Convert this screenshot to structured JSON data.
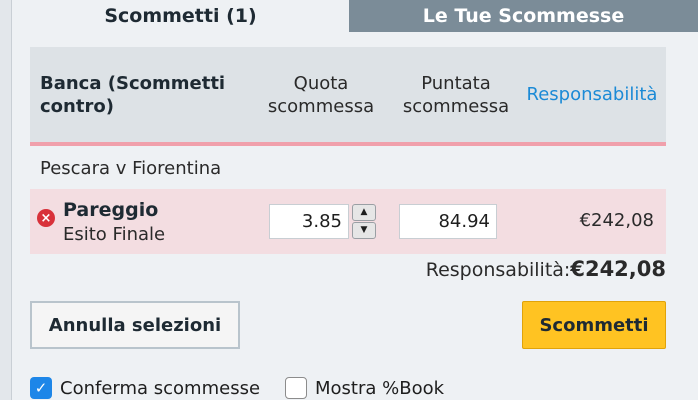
{
  "tabs": {
    "active_label": "Scommetti (1)",
    "inactive_label": "Le Tue Scommesse"
  },
  "table_header": {
    "banca": "Banca (Scommetti contro)",
    "quota": "Quota scommessa",
    "puntata": "Puntata scommessa",
    "responsabilita": "Responsabilità"
  },
  "event": {
    "name": "Pescara v Fiorentina"
  },
  "bet": {
    "selection": "Pareggio",
    "market": "Esito Finale",
    "odds": "3.85",
    "stake": "84.94",
    "liability": "€242,08",
    "remove_glyph": "×",
    "stepper_up": "▲",
    "stepper_down": "▼"
  },
  "summary": {
    "liability_label": "Responsabilità:",
    "liability_value": "€242,08"
  },
  "buttons": {
    "cancel": "Annulla selezioni",
    "place": "Scommetti"
  },
  "options": {
    "confirm_label": "Conferma scommesse",
    "confirm_checked": true,
    "book_label": "Mostra %Book",
    "book_checked": false,
    "check_glyph": "✓"
  },
  "colors": {
    "accent_blue": "#1b8ad6",
    "place_button": "#ffc322",
    "lay_row": "#f3dde1",
    "tab_inactive": "#7b8c98"
  }
}
